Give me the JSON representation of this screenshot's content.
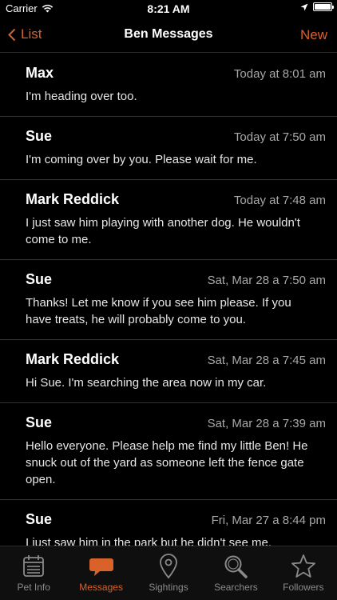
{
  "status_bar": {
    "carrier": "Carrier",
    "time": "8:21 AM",
    "battery_level": 1.0
  },
  "nav": {
    "back_label": "List",
    "title": "Ben Messages",
    "new_label": "New"
  },
  "messages": [
    {
      "author": "Max",
      "time": "Today at 8:01 am",
      "text": "I'm heading over too."
    },
    {
      "author": "Sue",
      "time": "Today at 7:50 am",
      "text": "I'm coming over by you. Please wait for me."
    },
    {
      "author": "Mark Reddick",
      "time": "Today at 7:48 am",
      "text": "I just saw him playing with another dog. He wouldn't come to me."
    },
    {
      "author": "Sue",
      "time": "Sat, Mar 28 a 7:50 am",
      "text": "Thanks! Let me know if you see him please. If you have treats, he will probably come to you."
    },
    {
      "author": "Mark Reddick",
      "time": "Sat, Mar 28 a 7:45 am",
      "text": "Hi Sue. I'm searching the area now in my car."
    },
    {
      "author": "Sue",
      "time": "Sat, Mar 28 a 7:39 am",
      "text": "Hello everyone. Please help me find my little Ben! He snuck out of the yard as someone left the fence gate open."
    },
    {
      "author": "Sue",
      "time": "Fri, Mar 27 a 8:44 pm",
      "text": "I just saw him in the park but he didn't see me."
    }
  ],
  "tabs": [
    {
      "label": "Pet Info",
      "icon": "calendar-icon"
    },
    {
      "label": "Messages",
      "icon": "speech-bubble-icon"
    },
    {
      "label": "Sightings",
      "icon": "map-pin-icon"
    },
    {
      "label": "Searchers",
      "icon": "magnifier-icon"
    },
    {
      "label": "Followers",
      "icon": "star-icon"
    }
  ],
  "colors": {
    "accent": "#d9622b",
    "background": "#000000",
    "separator": "#333333",
    "inactive_tab": "#8a8a8a"
  }
}
